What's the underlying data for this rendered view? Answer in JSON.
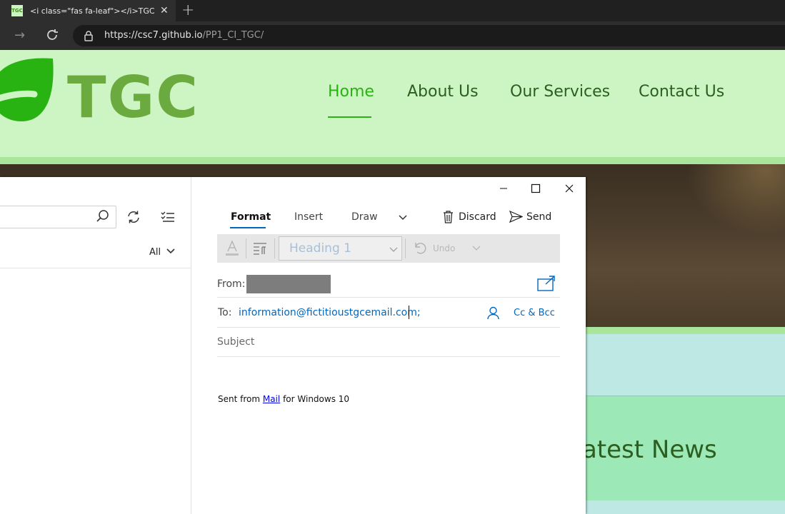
{
  "browser": {
    "tab": {
      "favicon_text": "TGC",
      "title": "<i class=\"fas fa-leaf\"></i>TGC |"
    },
    "url": {
      "scheme": "https://",
      "host": "csc7.github.io",
      "path": "/PP1_CI_TGC/"
    }
  },
  "site": {
    "logo_text": "TGC",
    "brand_color": "#6aaa3f",
    "nav": {
      "home": "Home",
      "about": "About Us",
      "services": "Our Services",
      "contact": "Contact Us",
      "active": "Home",
      "active_color": "#29b312"
    },
    "news_heading_visible": "Latest News"
  },
  "mail": {
    "filter_label": "All",
    "ribbon_tabs": {
      "format": "Format",
      "insert": "Insert",
      "draw": "Draw",
      "active": "Format"
    },
    "actions": {
      "discard": "Discard",
      "send": "Send"
    },
    "format_bar": {
      "style_value": "Heading 1",
      "undo_label": "Undo"
    },
    "from": {
      "label": "From:",
      "value": ""
    },
    "to": {
      "label": "To:",
      "value": "information@fictitioustgcemail.com;",
      "cc_bcc_label": "Cc & Bcc"
    },
    "subject": {
      "placeholder": "Subject",
      "value": ""
    },
    "signature": {
      "prefix": "Sent from ",
      "link": "Mail",
      "suffix": " for Windows 10"
    },
    "accent_color": "#0067c0"
  },
  "icons": [
    "leaf-icon",
    "close-icon",
    "new-tab-icon",
    "forward-icon",
    "reload-icon",
    "lock-icon",
    "search-icon",
    "sync-icon",
    "filter-icon",
    "chevron-down-icon",
    "minimize-icon",
    "maximize-icon",
    "trash-icon",
    "send-icon",
    "font-color-icon",
    "paragraph-icon",
    "undo-icon",
    "popout-icon",
    "contact-icon"
  ]
}
